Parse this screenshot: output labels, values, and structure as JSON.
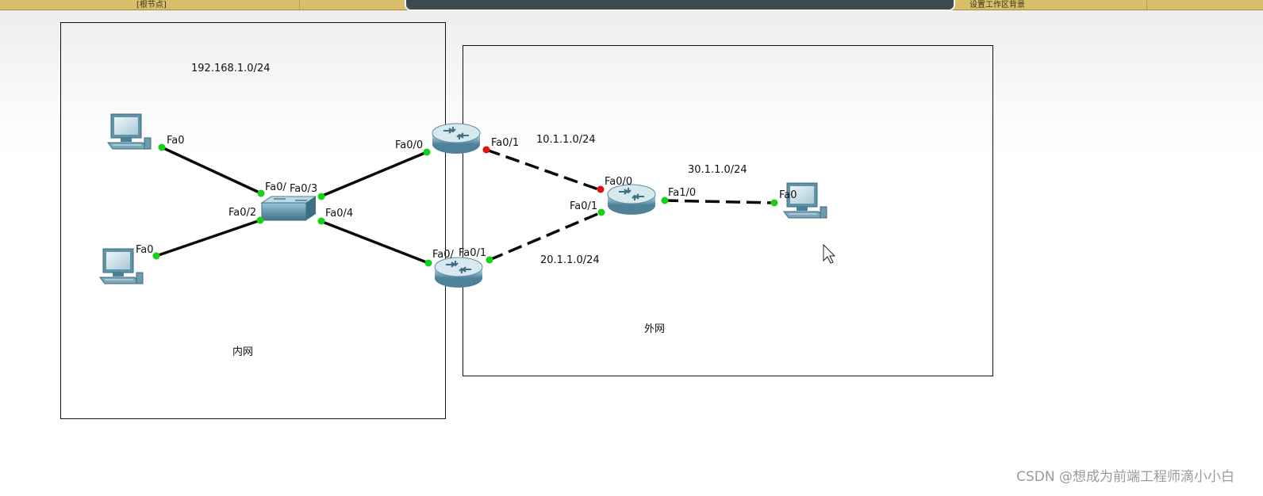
{
  "toolbar": {
    "left_label": "[根节点]",
    "right_label": "设置工作区背景"
  },
  "zones": {
    "inner_subnet": "192.168.1.0/24",
    "inner_name": "内网",
    "outer_name": "外网"
  },
  "networks": {
    "net_10": "10.1.1.0/24",
    "net_20": "20.1.1.0/24",
    "net_30": "30.1.1.0/24"
  },
  "ports": {
    "pc1_fa0": "Fa0",
    "pc2_fa0": "Fa0",
    "sw_fa0_1": "Fa0/",
    "sw_fa0_2": "Fa0/2",
    "sw_fa0_3": "Fa0/3",
    "sw_fa0_4": "Fa0/4",
    "r1_fa0_0": "Fa0/0",
    "r1_fa0_1": "Fa0/1",
    "r2_fa0_0": "Fa0/",
    "r2_fa0_1": "Fa0/1",
    "r3_fa0_0": "Fa0/0",
    "r3_fa0_1": "Fa0/1",
    "r3_fa1_0": "Fa1/0",
    "pc3_fa0": "Fa0"
  },
  "colors": {
    "link_up": "#18d018",
    "link_down": "#e01010",
    "device": "#6fa3b8"
  },
  "watermark": "CSDN @想成为前端工程师滴小小白"
}
